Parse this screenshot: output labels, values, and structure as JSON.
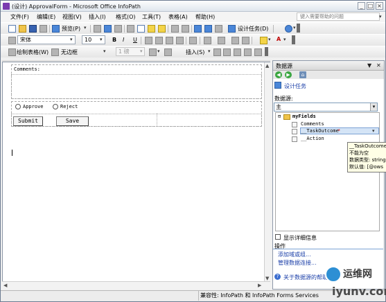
{
  "window": {
    "title": "(设计) ApprovalForm - Microsoft Office InfoPath",
    "minimize": "_",
    "maximize": "□",
    "close": "×"
  },
  "menu": {
    "items": [
      "文件(F)",
      "编辑(E)",
      "视图(V)",
      "插入(I)",
      "格式(O)",
      "工具(T)",
      "表格(A)",
      "帮助(H)"
    ],
    "help_placeholder": "键入需要帮助的问题"
  },
  "toolbar_standard": {
    "preview_label": "预览(P)",
    "design_tasks_label": "设计任务(D)"
  },
  "toolbar_format": {
    "font_name": "宋体",
    "font_size": "10",
    "bold": "B",
    "italic": "I",
    "underline": "U",
    "font_color_glyph": "A"
  },
  "toolbar_table": {
    "draw_table_label": "绘制表格(W)",
    "border_style": "无边框",
    "border_width": "1 磅",
    "insert_label": "插入(S)"
  },
  "form": {
    "comments_label": "Comments:",
    "radio_approve": "Approve",
    "radio_reject": "Reject",
    "submit_label": "Submit",
    "save_label": "Save"
  },
  "task_pane": {
    "title": "数据源",
    "design_tasks_link": "设计任务",
    "data_source_label": "数据源:",
    "data_source_selected": "主",
    "tree": {
      "root": "myFields",
      "children": [
        "Comments",
        "__TaskOutcome",
        "__Action"
      ],
      "required_marker": "*"
    },
    "tooltip": {
      "line1": "__TaskOutcome",
      "line2": "不能为空",
      "line3": "数据类型: string",
      "line4": "默认值: [@ows"
    },
    "show_details_label": "显示详细信息",
    "actions_label": "操作",
    "add_field_link": "添加域或组...",
    "manage_connections_link": "管理数据连接...",
    "help_link": "关于数据源的帮助"
  },
  "status": {
    "compatibility": "兼容性: InfoPath 和 InfoPath Forms Services"
  },
  "watermark": {
    "brand": "运维网",
    "url": "iyunv.com"
  }
}
